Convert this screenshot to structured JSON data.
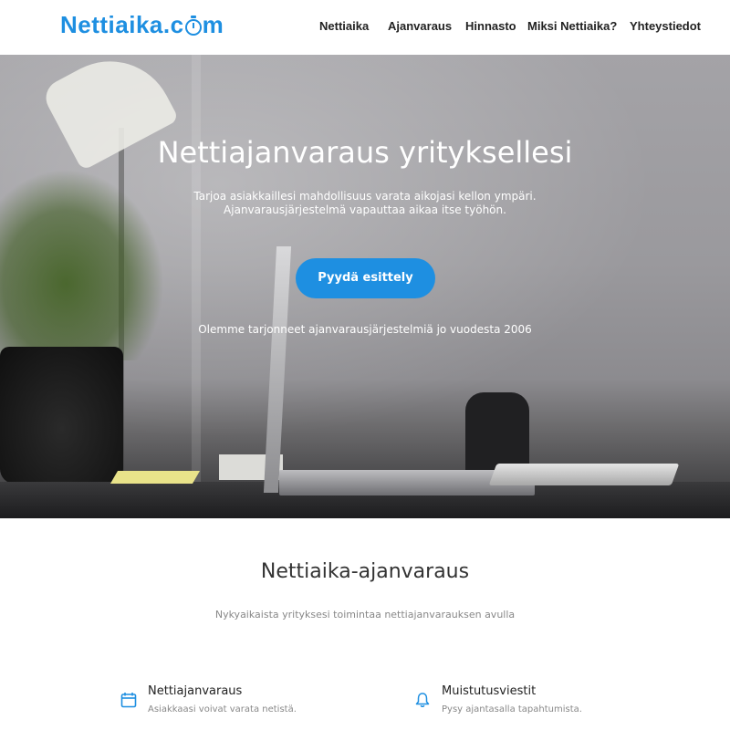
{
  "header": {
    "logo_text_before": "Nettiaika.c",
    "logo_text_after": "m",
    "nav": [
      {
        "label": "Nettiaika"
      },
      {
        "label": "Ajanvaraus"
      },
      {
        "label": "Hinnasto"
      },
      {
        "label": "Miksi Nettiaika?"
      },
      {
        "label": "Yhteystiedot"
      }
    ]
  },
  "hero": {
    "title": "Nettiajanvaraus yrityksellesi",
    "subtitle_line1": "Tarjoa asiakkaillesi mahdollisuus varata aikojasi kellon ympäri.",
    "subtitle_line2": "Ajanvarausjärjestelmä vapauttaa aikaa itse työhön.",
    "cta_label": "Pyydä esittely",
    "note": "Olemme tarjonneet ajanvarausjärjestelmiä jo vuodesta 2006"
  },
  "section": {
    "title": "Nettiaika-ajanvaraus",
    "subtitle": "Nykyaikaista yrityksesi toimintaa nettiajanvarauksen avulla"
  },
  "features": [
    {
      "title": "Nettiajanvaraus",
      "description": "Asiakkaasi voivat varata netistä.",
      "icon": "calendar-icon"
    },
    {
      "title": "Muistutusviestit",
      "description": "Pysy ajantasalla tapahtumista.",
      "icon": "bell-icon"
    }
  ],
  "colors": {
    "accent": "#1e8fe1",
    "text_dark": "#333333",
    "text_muted": "#888888"
  }
}
